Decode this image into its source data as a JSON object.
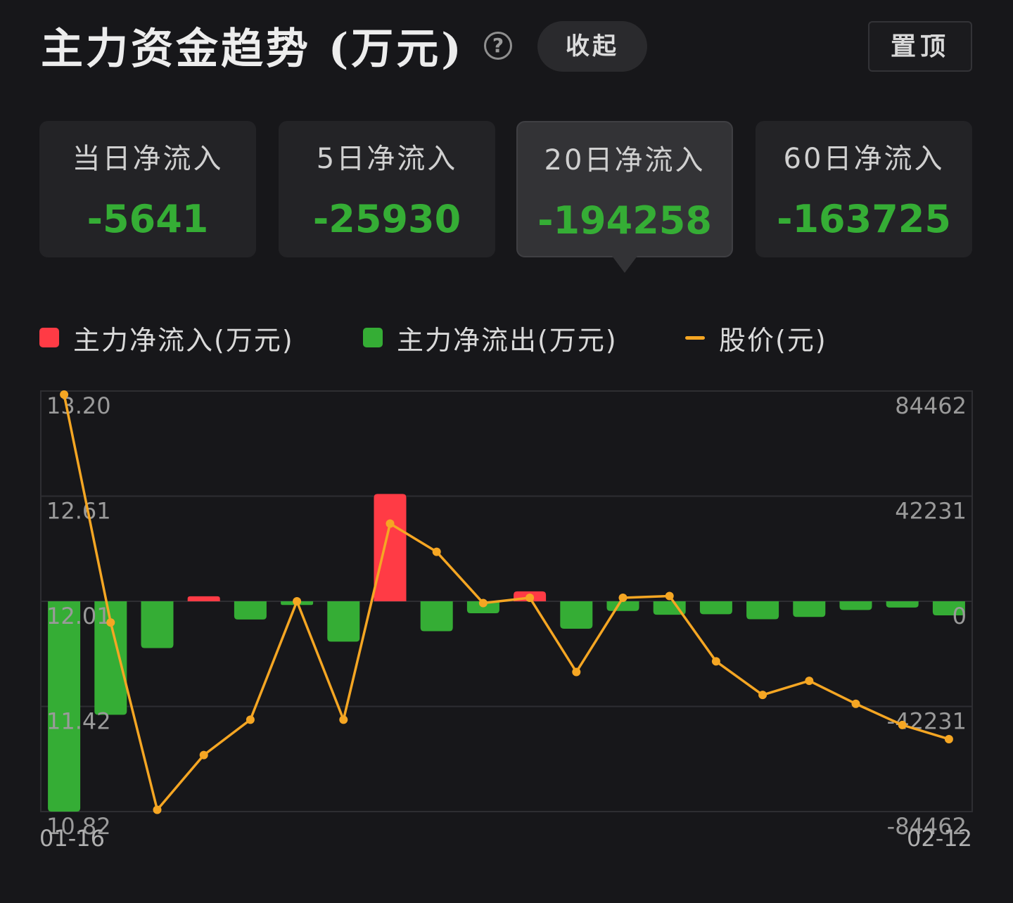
{
  "header": {
    "title": "主力资金趋势 (万元)",
    "help_icon": "question-circle-icon",
    "help_glyph": "?",
    "collapse_label": "收起",
    "pin_label": "置顶"
  },
  "stats": [
    {
      "label": "当日净流入",
      "value": "-5641",
      "active": false
    },
    {
      "label": "5日净流入",
      "value": "-25930",
      "active": false
    },
    {
      "label": "20日净流入",
      "value": "-194258",
      "active": true
    },
    {
      "label": "60日净流入",
      "value": "-163725",
      "active": false
    }
  ],
  "legend": {
    "inflow": "主力净流入(万元)",
    "outflow": "主力净流出(万元)",
    "price": "股价(元)"
  },
  "colors": {
    "inflow": "#ff3b45",
    "outflow": "#35ad35",
    "price": "#f5a623",
    "grid": "#2e2e32",
    "background": "#17171a"
  },
  "chart_data": {
    "type": "bar",
    "x_start_label": "01-16",
    "x_end_label": "02-12",
    "left_axis_ticks": [
      "13.20",
      "12.61",
      "12.01",
      "11.42",
      "10.82"
    ],
    "right_axis_ticks": [
      "84462",
      "42231",
      "0",
      "-42231",
      "-84462"
    ],
    "left_ylim": [
      10.82,
      13.2
    ],
    "right_ylim": [
      -84462,
      84462
    ],
    "grid": true,
    "series": [
      {
        "name": "主力净流入(万元)/主力净流出(万元)",
        "type": "bar",
        "values": [
          -84462,
          -45600,
          -18800,
          2000,
          -7300,
          -1500,
          -16200,
          43100,
          -12000,
          -4800,
          4000,
          -11000,
          -3900,
          -5400,
          -5200,
          -7200,
          -6300,
          -3500,
          -2500,
          -5641
        ]
      },
      {
        "name": "股价(元)",
        "type": "line",
        "values": [
          13.18,
          11.89,
          10.83,
          11.14,
          11.34,
          12.01,
          11.34,
          12.45,
          12.29,
          12.0,
          12.03,
          11.61,
          12.03,
          12.04,
          11.67,
          11.48,
          11.56,
          11.43,
          11.31,
          11.23
        ]
      }
    ]
  }
}
